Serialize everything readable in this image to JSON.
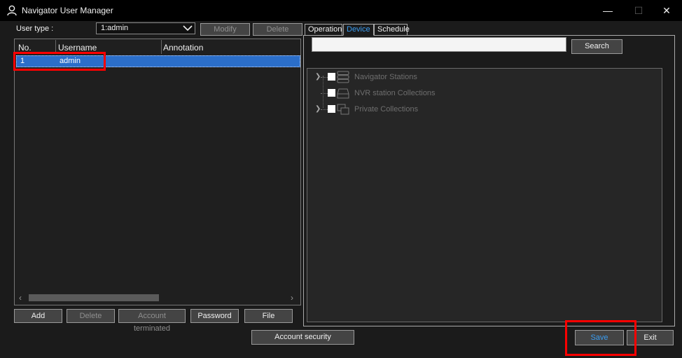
{
  "window": {
    "title": "Navigator User Manager",
    "icon": "user-icon",
    "controls": [
      "minimize",
      "maximize",
      "close"
    ]
  },
  "left": {
    "user_type_label": "User type :",
    "user_type_value": "1:admin",
    "modify_label": "Modify",
    "delete_top_label": "Delete",
    "table": {
      "columns": [
        "No.",
        "Username",
        "Annotation"
      ],
      "rows": [
        {
          "no": "1",
          "username": "admin",
          "annotation": ""
        }
      ]
    },
    "buttons": {
      "add": "Add",
      "delete": "Delete",
      "account_terminated": "Account terminated",
      "password": "Password",
      "file": "File"
    }
  },
  "right": {
    "tabs": [
      "Operation",
      "Device",
      "Schedule"
    ],
    "active_tab": "Device",
    "search_value": "",
    "search_label": "Search",
    "tree": [
      {
        "label": "Navigator Stations",
        "icon": "server-stack-icon",
        "expandable": true
      },
      {
        "label": "NVR station Collections",
        "icon": "nvr-device-icon",
        "expandable": false
      },
      {
        "label": "Private Collections",
        "icon": "windows-collection-icon",
        "expandable": true
      }
    ]
  },
  "footer": {
    "account_security": "Account security",
    "save": "Save",
    "exit": "Exit"
  },
  "colors": {
    "accent": "#3a9cf0",
    "selection": "#2b6ec9",
    "highlight": "#ff0000"
  }
}
